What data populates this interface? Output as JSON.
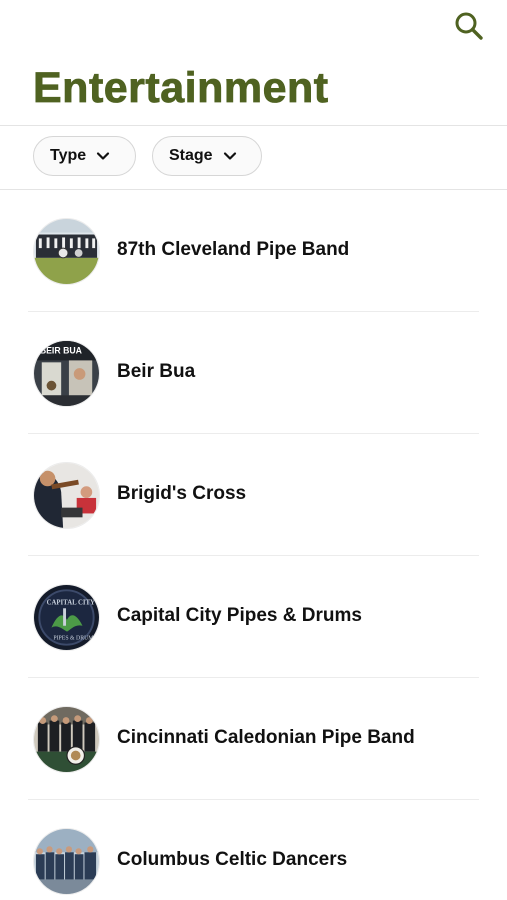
{
  "header": {
    "title": "Entertainment",
    "search_icon": "search-icon"
  },
  "filters": {
    "type_label": "Type",
    "stage_label": "Stage",
    "chevron_icon": "chevron-down-icon"
  },
  "colors": {
    "accent": "#4f6221",
    "text": "#111111",
    "divider": "#e4e4e4"
  },
  "entertainers": [
    {
      "name": "87th Cleveland Pipe Band"
    },
    {
      "name": "Beir Bua"
    },
    {
      "name": "Brigid's Cross"
    },
    {
      "name": "Capital City Pipes & Drums"
    },
    {
      "name": "Cincinnati Caledonian Pipe Band"
    },
    {
      "name": "Columbus Celtic Dancers"
    }
  ]
}
